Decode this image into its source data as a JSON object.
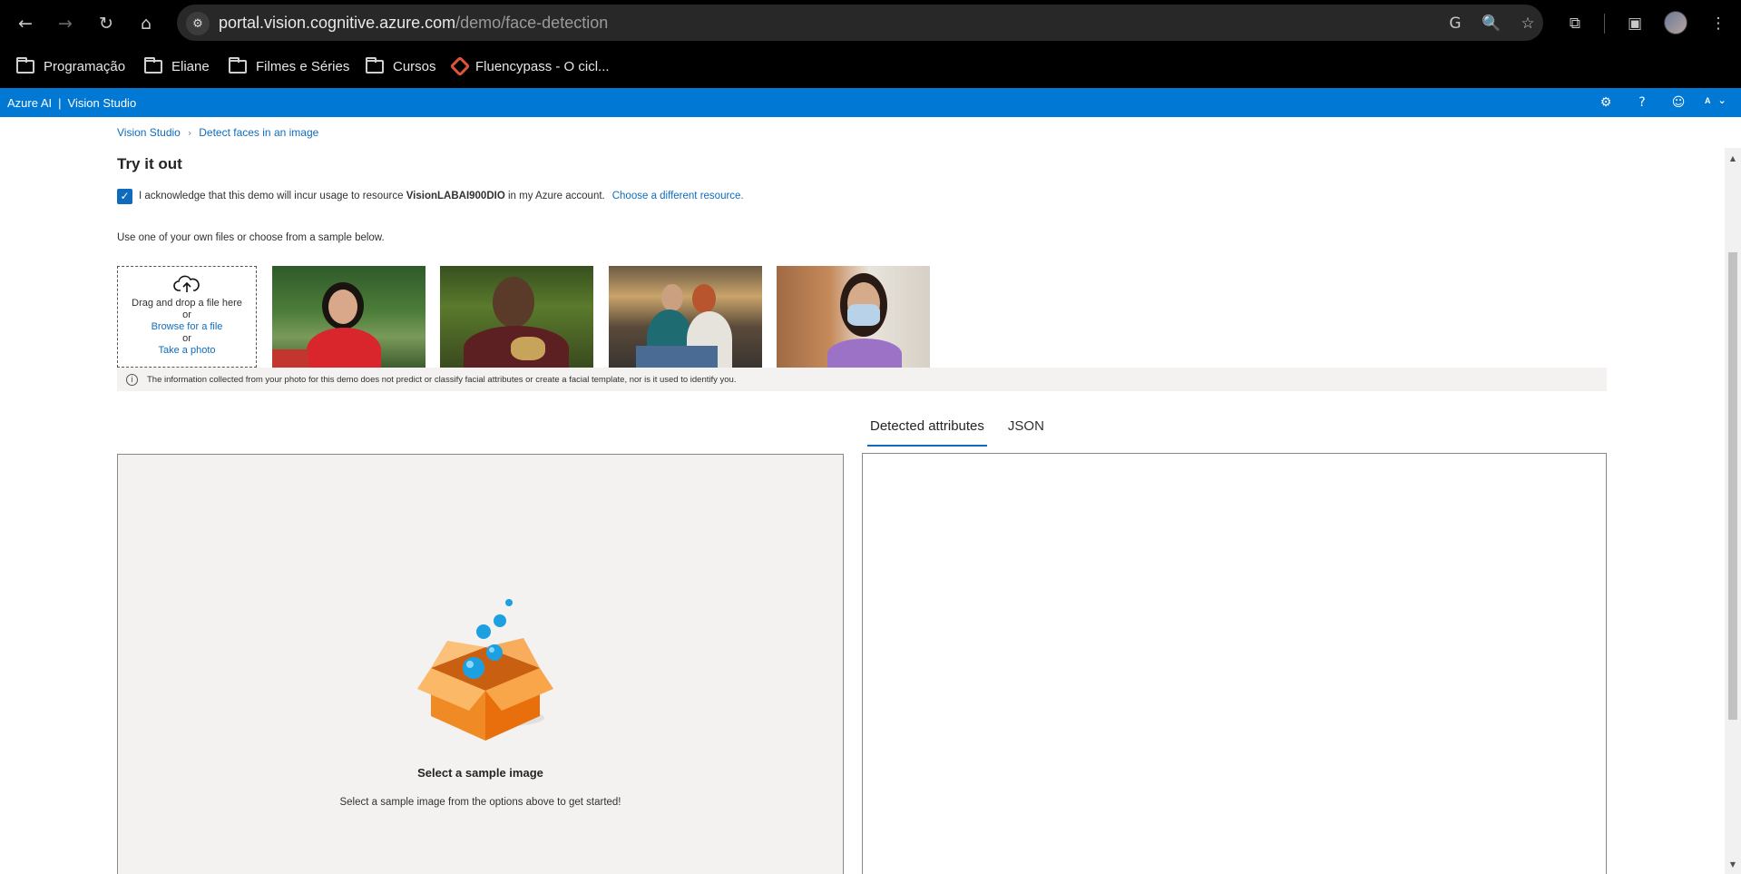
{
  "browser": {
    "url_host": "portal.vision.cognitive.azure.com",
    "url_path": "/demo/face-detection",
    "bookmarks": [
      {
        "label": "Programação",
        "icon": "folder-icon"
      },
      {
        "label": "Eliane",
        "icon": "folder-icon"
      },
      {
        "label": "Filmes e Séries",
        "icon": "folder-icon"
      },
      {
        "label": "Cursos",
        "icon": "folder-icon"
      },
      {
        "label": "Fluencypass - O cicl...",
        "icon": "fluencypass-icon"
      }
    ]
  },
  "azure": {
    "brand": "Azure AI",
    "product": "Vision Studio",
    "user_initial": "A"
  },
  "breadcrumb": {
    "root": "Vision Studio",
    "current": "Detect faces in an image"
  },
  "page": {
    "title": "Try it out",
    "ack_prefix": "I acknowledge that this demo will incur usage to resource",
    "ack_resource": "VisionLABAI900DIO",
    "ack_suffix": "in my Azure account.",
    "ack_link": "Choose a different resource.",
    "ack_checked": true,
    "intro": "Use one of your own files or choose from a sample below."
  },
  "upload": {
    "drag_text": "Drag and drop a file here",
    "or1": "or",
    "browse_link": "Browse for a file",
    "or2": "or",
    "photo_link": "Take a photo"
  },
  "info_notice": "The information collected from your photo for this demo does not predict or classify facial attributes or create a facial template, nor is it used to identify you.",
  "tabs": [
    {
      "label": "Detected attributes",
      "active": true
    },
    {
      "label": "JSON",
      "active": false
    }
  ],
  "empty_state": {
    "title": "Select a sample image",
    "subtitle": "Select a sample image from the options above to get started!"
  },
  "colors": {
    "azure_blue": "#0078d4",
    "link": "#0f6cbd",
    "panel_bg": "#f3f2f1"
  }
}
